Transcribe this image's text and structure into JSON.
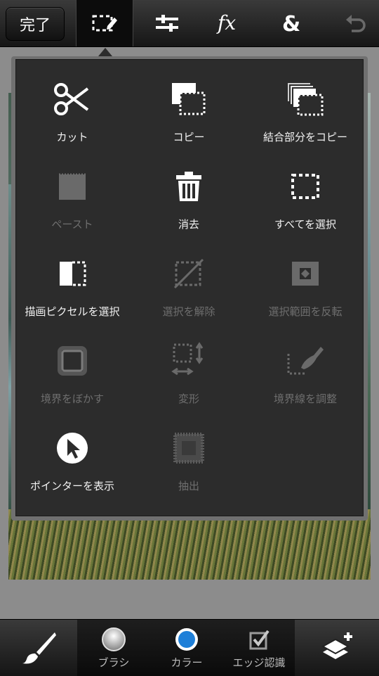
{
  "toolbar": {
    "done_label": "完了",
    "tools": [
      {
        "name": "selection-tool",
        "icon": "marquee-pencil-icon",
        "active": true
      },
      {
        "name": "adjust-tool",
        "icon": "sliders-icon",
        "active": false
      },
      {
        "name": "effects-tool",
        "icon": "fx-icon",
        "active": false
      },
      {
        "name": "blend-tool",
        "icon": "ampersand-icon",
        "active": false
      },
      {
        "name": "undo-tool",
        "icon": "undo-icon",
        "active": false
      }
    ]
  },
  "menu": {
    "items": [
      {
        "label": "カット",
        "icon": "scissors-icon",
        "enabled": true
      },
      {
        "label": "コピー",
        "icon": "copy-icon",
        "enabled": true
      },
      {
        "label": "結合部分をコピー",
        "icon": "copy-merged-icon",
        "enabled": true
      },
      {
        "label": "ペースト",
        "icon": "paste-icon",
        "enabled": false
      },
      {
        "label": "消去",
        "icon": "trash-icon",
        "enabled": true
      },
      {
        "label": "すべてを選択",
        "icon": "select-all-icon",
        "enabled": true
      },
      {
        "label": "描画ピクセルを選択",
        "icon": "select-pixels-icon",
        "enabled": true
      },
      {
        "label": "選択を解除",
        "icon": "deselect-icon",
        "enabled": false
      },
      {
        "label": "選択範囲を反転",
        "icon": "invert-selection-icon",
        "enabled": false
      },
      {
        "label": "境界をぼかす",
        "icon": "feather-icon",
        "enabled": false
      },
      {
        "label": "変形",
        "icon": "transform-icon",
        "enabled": false
      },
      {
        "label": "境界線を調整",
        "icon": "refine-edge-icon",
        "enabled": false
      },
      {
        "label": "ポインターを表示",
        "icon": "pointer-icon",
        "enabled": true
      },
      {
        "label": "抽出",
        "icon": "extract-icon",
        "enabled": false
      }
    ]
  },
  "bottom": {
    "brush_label": "ブラシ",
    "color_label": "カラー",
    "edge_label": "エッジ認識",
    "accent": "#1e7fd8"
  }
}
